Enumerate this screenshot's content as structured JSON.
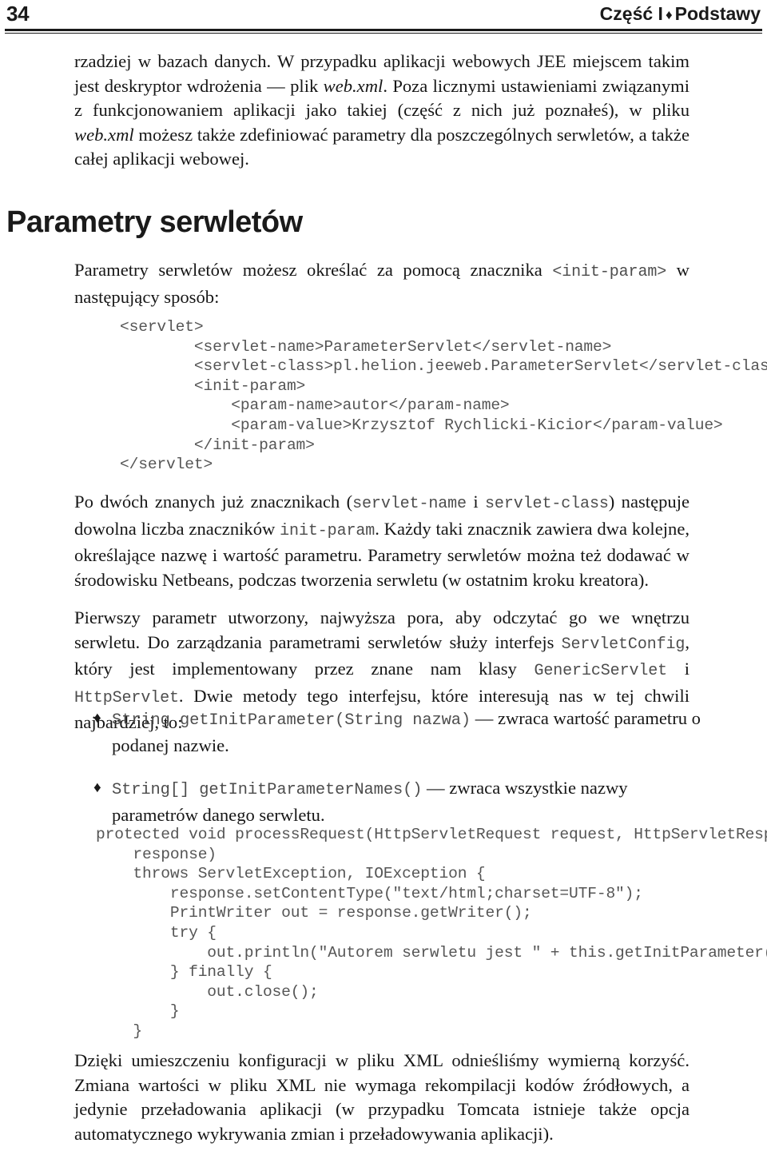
{
  "running_head": {
    "folio": "34",
    "part_label": "Część I",
    "separator": "♦",
    "section_title": "Podstawy"
  },
  "content": {
    "intro_paragraph": {
      "seg1": "rzadziej w bazach danych. W przypadku aplikacji webowych JEE miejscem takim jest deskryptor wdrożenia — plik ",
      "italic1": "web.xml",
      "seg2": ". Poza licznymi ustawieniami związanymi z funkcjonowaniem aplikacji jako takiej (część z nich już poznałeś), w pliku ",
      "italic2": "web.xml",
      "seg3": " możesz także zdefiniować parametry dla poszczególnych serwletów, a także całej aplikacji webowej."
    },
    "section_heading": "Parametry serwletów",
    "lead_paragraph": {
      "seg1": "Parametry serwletów możesz określać za pomocą znacznika ",
      "code1": "<init-param>",
      "seg2": " w następujący sposób:"
    },
    "xml_listing": "<servlet>\n        <servlet-name>ParameterServlet</servlet-name>\n        <servlet-class>pl.helion.jeeweb.ParameterServlet</servlet-class>\n        <init-param>\n            <param-name>autor</param-name>\n            <param-value>Krzysztof Rychlicki-Kicior</param-value>\n        </init-param>\n</servlet>",
    "paragraph_after_xml": {
      "seg1": "Po dwóch znanych już znacznikach (",
      "code1": "servlet-name",
      "seg2": " i ",
      "code2": "servlet-class",
      "seg3": ") następuje dowolna liczba znaczników ",
      "code3": "init-param",
      "seg4": ". Każdy taki znacznik zawiera dwa kolejne, określające nazwę i wartość parametru. Parametry serwletów można też dodawać w środowisku Netbeans, podczas tworzenia serwletu (w ostatnim kroku kreatora)."
    },
    "paragraph_config": {
      "seg1": "Pierwszy parametr utworzony, najwyższa pora, aby odczytać go we wnętrzu serwletu. Do zarządzania parametrami serwletów służy interfejs ",
      "code1": "ServletConfig",
      "seg2": ", który jest implementowany przez znane nam klasy ",
      "code2": "GenericServlet",
      "seg3": " i ",
      "code3": "HttpServlet",
      "seg4": ". Dwie metody tego interfejsu, które interesują nas w tej chwili najbardziej, to:"
    },
    "method_list": [
      {
        "bullet": "♦",
        "signature": "String getInitParameter(String nazwa)",
        "dash": " — ",
        "description": "zwraca wartość parametru o podanej nazwie."
      },
      {
        "bullet": "♦",
        "signature": "String[] getInitParameterNames()",
        "dash": " — ",
        "description": "zwraca wszystkie nazwy parametrów danego serwletu."
      }
    ],
    "java_listing": "protected void processRequest(HttpServletRequest request, HttpServletResponse\n    response)\n    throws ServletException, IOException {\n        response.setContentType(\"text/html;charset=UTF-8\");\n        PrintWriter out = response.getWriter();\n        try {\n            out.println(\"Autorem serwletu jest \" + this.getInitParameter(\"autor\"));\n        } finally {\n            out.close();\n        }\n    }",
    "closing_paragraph": "Dzięki umieszczeniu konfiguracji w pliku XML odnieśliśmy wymierną korzyść. Zmiana wartości w pliku XML nie wymaga rekompilacji kodów źródłowych, a jedynie przeładowania aplikacji (w przypadku Tomcata istnieje także opcja automatycznego wykrywania zmian i przeładowywania aplikacji)."
  }
}
